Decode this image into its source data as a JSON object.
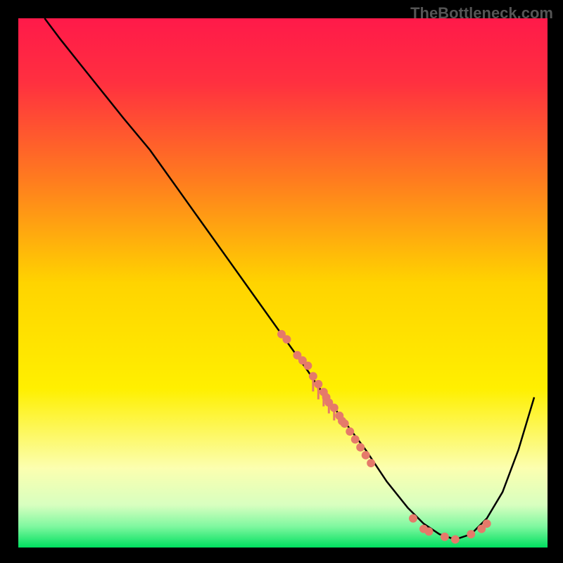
{
  "watermark": "TheBottleneck.com",
  "chart_data": {
    "type": "line",
    "title": "",
    "xlabel": "",
    "ylabel": "",
    "xlim": [
      0,
      100
    ],
    "ylim": [
      0,
      100
    ],
    "grid": false,
    "legend": false,
    "background_gradient_stops": [
      {
        "pos": 0.0,
        "color": "#ff1a4a"
      },
      {
        "pos": 0.12,
        "color": "#ff3040"
      },
      {
        "pos": 0.3,
        "color": "#ff7a20"
      },
      {
        "pos": 0.5,
        "color": "#ffd400"
      },
      {
        "pos": 0.7,
        "color": "#fff000"
      },
      {
        "pos": 0.85,
        "color": "#fcffb0"
      },
      {
        "pos": 0.92,
        "color": "#d8ffc0"
      },
      {
        "pos": 0.96,
        "color": "#80f8a0"
      },
      {
        "pos": 1.0,
        "color": "#00e060"
      }
    ],
    "series": [
      {
        "name": "curve",
        "color": "#000000",
        "x": [
          5,
          8,
          12,
          16,
          20,
          25,
          30,
          35,
          40,
          45,
          50,
          55,
          57,
          60,
          63,
          66,
          70,
          74,
          77,
          80,
          83,
          86,
          89,
          92,
          95,
          98
        ],
        "y": [
          100,
          96,
          91,
          86,
          81,
          75,
          68,
          61,
          54,
          47,
          40,
          33,
          30,
          26,
          22,
          18,
          12,
          7,
          4,
          2,
          1,
          2,
          5,
          10,
          18,
          28
        ]
      }
    ],
    "scatter_points": {
      "color": "#e57a6a",
      "radius": 6,
      "points": [
        {
          "x": 50,
          "y": 40
        },
        {
          "x": 51,
          "y": 39
        },
        {
          "x": 53,
          "y": 36
        },
        {
          "x": 54,
          "y": 35
        },
        {
          "x": 55,
          "y": 34
        },
        {
          "x": 56,
          "y": 32
        },
        {
          "x": 57,
          "y": 30.5
        },
        {
          "x": 58,
          "y": 29
        },
        {
          "x": 58.5,
          "y": 28
        },
        {
          "x": 59,
          "y": 27
        },
        {
          "x": 60,
          "y": 26
        },
        {
          "x": 61,
          "y": 24.5
        },
        {
          "x": 61.5,
          "y": 23.5
        },
        {
          "x": 62,
          "y": 23
        },
        {
          "x": 63,
          "y": 21.5
        },
        {
          "x": 64,
          "y": 20
        },
        {
          "x": 65,
          "y": 18.5
        },
        {
          "x": 66,
          "y": 17
        },
        {
          "x": 67,
          "y": 15.5
        },
        {
          "x": 75,
          "y": 5
        },
        {
          "x": 77,
          "y": 3
        },
        {
          "x": 78,
          "y": 2.5
        },
        {
          "x": 81,
          "y": 1.5
        },
        {
          "x": 83,
          "y": 1
        },
        {
          "x": 86,
          "y": 2
        },
        {
          "x": 88,
          "y": 3
        },
        {
          "x": 89,
          "y": 4
        }
      ]
    },
    "vertical_ticks": {
      "color": "#e57a6a",
      "comment": "short downward strokes along the curve segment",
      "x_positions": [
        56,
        57,
        58,
        59,
        60
      ]
    }
  }
}
